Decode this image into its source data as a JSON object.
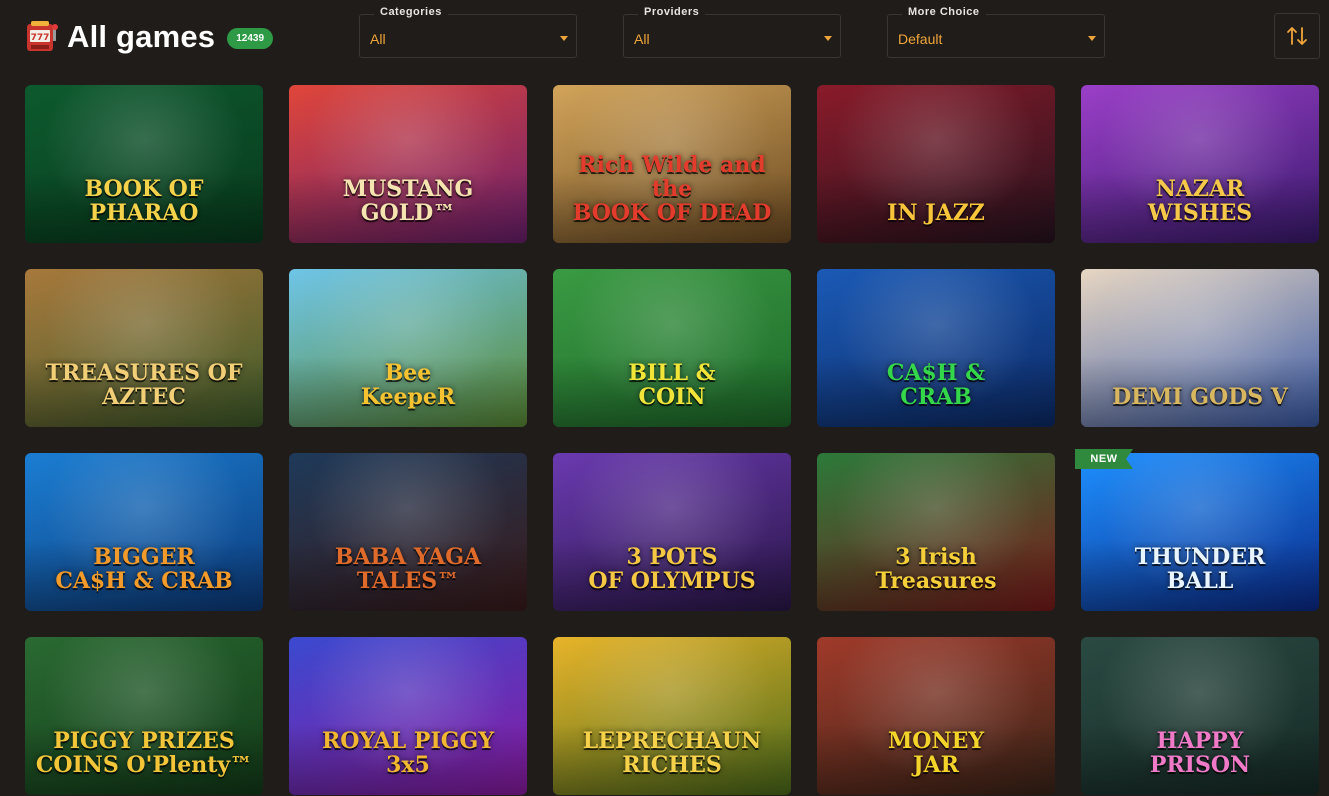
{
  "header": {
    "title": "All games",
    "count": "12439",
    "slot_icon": "slot-machine-icon"
  },
  "filters": [
    {
      "label": "Categories",
      "value": "All"
    },
    {
      "label": "Providers",
      "value": "All"
    },
    {
      "label": "More Choice",
      "value": "Default"
    }
  ],
  "sort_icon": "sort-arrows-icon",
  "accent_color": "#f0a53a",
  "games": [
    {
      "title": "BOOK OF PHARAO",
      "bg1": "#0d5a2e",
      "bg2": "#083a1d",
      "fg": "#f4d34a"
    },
    {
      "title": "MUSTANG\nGOLD™",
      "bg1": "#e0463a",
      "bg2": "#6a1f6e",
      "fg": "#f5e3b0"
    },
    {
      "title": "Rich Wilde and the\nBOOK OF DEAD",
      "bg1": "#d2a45a",
      "bg2": "#6b4a22",
      "fg": "#e33c2c"
    },
    {
      "title": "IN JAZZ",
      "bg1": "#8a1b2a",
      "bg2": "#26121e",
      "fg": "#f7c43a"
    },
    {
      "title": "NAZAR\nWISHES",
      "bg1": "#9b3fc8",
      "bg2": "#3a1a6e",
      "fg": "#f5c84a"
    },
    {
      "title": "TREASURES OF\nAZTEC",
      "bg1": "#a8793c",
      "bg2": "#3d5a2a",
      "fg": "#f2cf76"
    },
    {
      "title": "Bee\nKeepeR",
      "bg1": "#6fc5e8",
      "bg2": "#5a8a34",
      "fg": "#f5c232"
    },
    {
      "title": "BILL &\nCOIN",
      "bg1": "#3a9a43",
      "bg2": "#1e6a2a",
      "fg": "#f1e53a"
    },
    {
      "title": "CA$H &\nCRAB",
      "bg1": "#1b5ab6",
      "bg2": "#0c2a66",
      "fg": "#34d64a"
    },
    {
      "title": "DEMI GODS V",
      "bg1": "#e7d6c2",
      "bg2": "#3a5aa6",
      "fg": "#d8b760"
    },
    {
      "title": "BIGGER\nCA$H & CRAB",
      "bg1": "#1b7ed3",
      "bg2": "#0c3a7a",
      "fg": "#f29a2a"
    },
    {
      "title": "BABA YAGA TALES™",
      "bg1": "#1e3a5a",
      "bg2": "#3a1a1a",
      "fg": "#e06a2a"
    },
    {
      "title": "3 POTS\nOF OLYMPUS",
      "bg1": "#6a3ab0",
      "bg2": "#2a1648",
      "fg": "#f5c843"
    },
    {
      "title": "3 Irish\nTreasures",
      "bg1": "#2b7a3a",
      "bg2": "#7a1a1a",
      "fg": "#f5cf3a"
    },
    {
      "title": "THUNDER\nBALL",
      "bg1": "#1e90ff",
      "bg2": "#0a2a8a",
      "fg": "#e8f4ff"
    },
    {
      "title": "PIGGY PRIZES\nCOINS O'Plenty™",
      "bg1": "#2a6a32",
      "bg2": "#123a18",
      "fg": "#f3c63a"
    },
    {
      "title": "ROYAL PIGGY\n3x5",
      "bg1": "#3a4ad0",
      "bg2": "#8a1aa0",
      "fg": "#f2b731"
    },
    {
      "title": "LEPRECHAUN\nRICHES",
      "bg1": "#e8b42a",
      "bg2": "#4a6a1a",
      "fg": "#f6d14a"
    },
    {
      "title": "MONEY\nJAR",
      "bg1": "#a03a2a",
      "bg2": "#3a2418",
      "fg": "#f4d42a"
    },
    {
      "title": "HAPPY\nPRISON",
      "bg1": "#2a4a42",
      "bg2": "#162a26",
      "fg": "#f07ac8"
    }
  ],
  "new_badge": "NEW"
}
